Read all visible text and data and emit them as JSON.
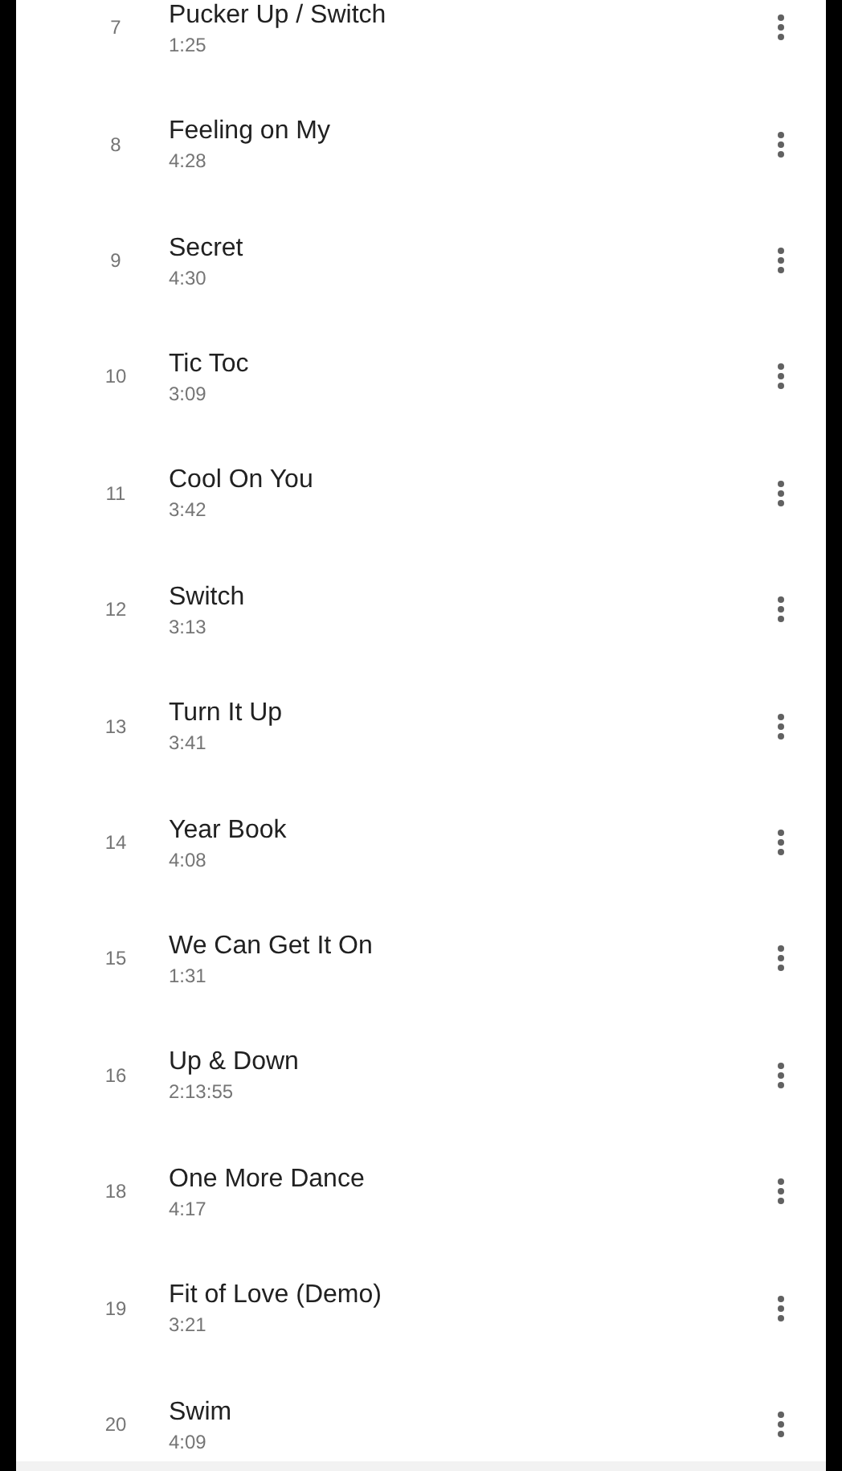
{
  "tracks": [
    {
      "number": "7",
      "title": "Pucker Up / Switch",
      "duration": "1:25"
    },
    {
      "number": "8",
      "title": "Feeling on My",
      "duration": "4:28"
    },
    {
      "number": "9",
      "title": "Secret",
      "duration": "4:30"
    },
    {
      "number": "10",
      "title": "Tic Toc",
      "duration": "3:09"
    },
    {
      "number": "11",
      "title": "Cool On You",
      "duration": "3:42"
    },
    {
      "number": "12",
      "title": "Switch",
      "duration": "3:13"
    },
    {
      "number": "13",
      "title": "Turn It Up",
      "duration": "3:41"
    },
    {
      "number": "14",
      "title": "Year Book",
      "duration": "4:08"
    },
    {
      "number": "15",
      "title": "We Can Get It On",
      "duration": "1:31"
    },
    {
      "number": "16",
      "title": "Up & Down",
      "duration": "2:13:55"
    },
    {
      "number": "18",
      "title": "One More Dance",
      "duration": "4:17"
    },
    {
      "number": "19",
      "title": "Fit of Love (Demo)",
      "duration": "3:21"
    },
    {
      "number": "20",
      "title": "Swim",
      "duration": "4:09"
    }
  ]
}
